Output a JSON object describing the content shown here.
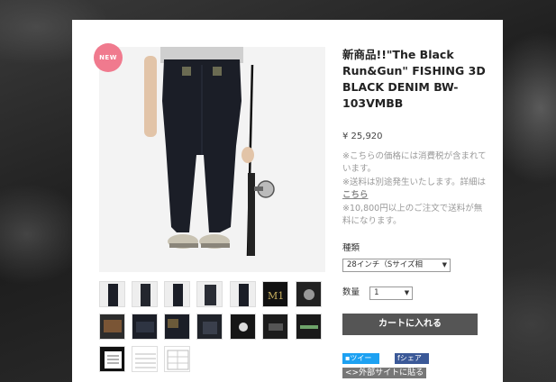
{
  "product": {
    "badge": "NEW",
    "title": "新商品!!\"The Black Run&Gun\" FISHING 3D BLACK DENIM BW-103VMBB",
    "price": "¥ 25,920",
    "notes": [
      "※こちらの価格には消費税が含まれています。",
      "※送料は別途発生いたします。詳細は",
      "※10,800円以上のご注文で送料が無料になります。"
    ],
    "notes_link": "こちら",
    "variant_label": "種類",
    "variant_value": "28インチ（Sサイズ相",
    "quantity_label": "数量",
    "quantity_value": "1",
    "cart_button": "カートに入れる"
  },
  "share": {
    "twitter": "ツイート",
    "facebook": "シェア",
    "external": "<>外部サイトに貼る"
  },
  "thumbnail_count": 17,
  "colors": {
    "badge": "#f07a8e",
    "cart_button": "#555555",
    "twitter": "#1da1f2",
    "facebook": "#3b5998"
  }
}
